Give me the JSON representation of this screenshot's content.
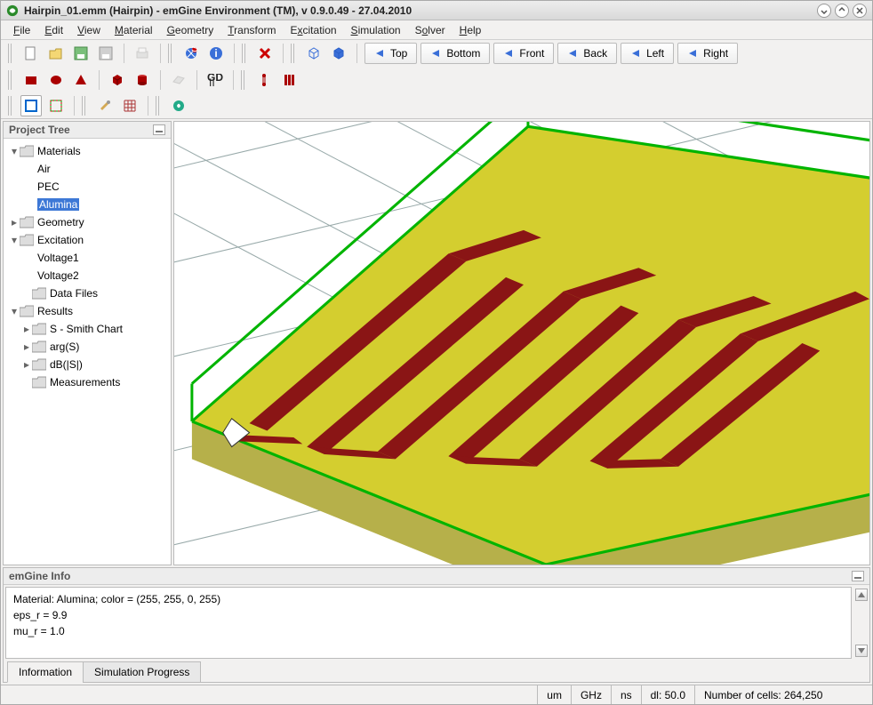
{
  "window": {
    "title": "Hairpin_01.emm (Hairpin) - emGine Environment (TM), v 0.9.0.49 - 27.04.2010"
  },
  "menu": {
    "file": "File",
    "edit": "Edit",
    "view": "View",
    "material": "Material",
    "geometry": "Geometry",
    "transform": "Transform",
    "excitation": "Excitation",
    "simulation": "Simulation",
    "solver": "Solver",
    "help": "Help"
  },
  "viewbuttons": {
    "top": "Top",
    "bottom": "Bottom",
    "front": "Front",
    "back": "Back",
    "left": "Left",
    "right": "Right"
  },
  "tree": {
    "title": "Project Tree",
    "materials": "Materials",
    "air": "Air",
    "pec": "PEC",
    "alumina": "Alumina",
    "geometry": "Geometry",
    "excitation": "Excitation",
    "voltage1": "Voltage1",
    "voltage2": "Voltage2",
    "datafiles": "Data Files",
    "results": "Results",
    "smith": "S - Smith Chart",
    "args": "arg(S)",
    "dbs": "dB(|S|)",
    "measurements": "Measurements"
  },
  "info": {
    "title": "emGine Info",
    "line1": "Material: Alumina; color = (255, 255, 0, 255)",
    "line2": " eps_r = 9.9",
    "line3": " mu_r = 1.0",
    "tab1": "Information",
    "tab2": "Simulation Progress"
  },
  "status": {
    "um": "um",
    "ghz": "GHz",
    "ns": "ns",
    "dl": "dl: 50.0",
    "cells": "Number of cells: 264,250"
  }
}
